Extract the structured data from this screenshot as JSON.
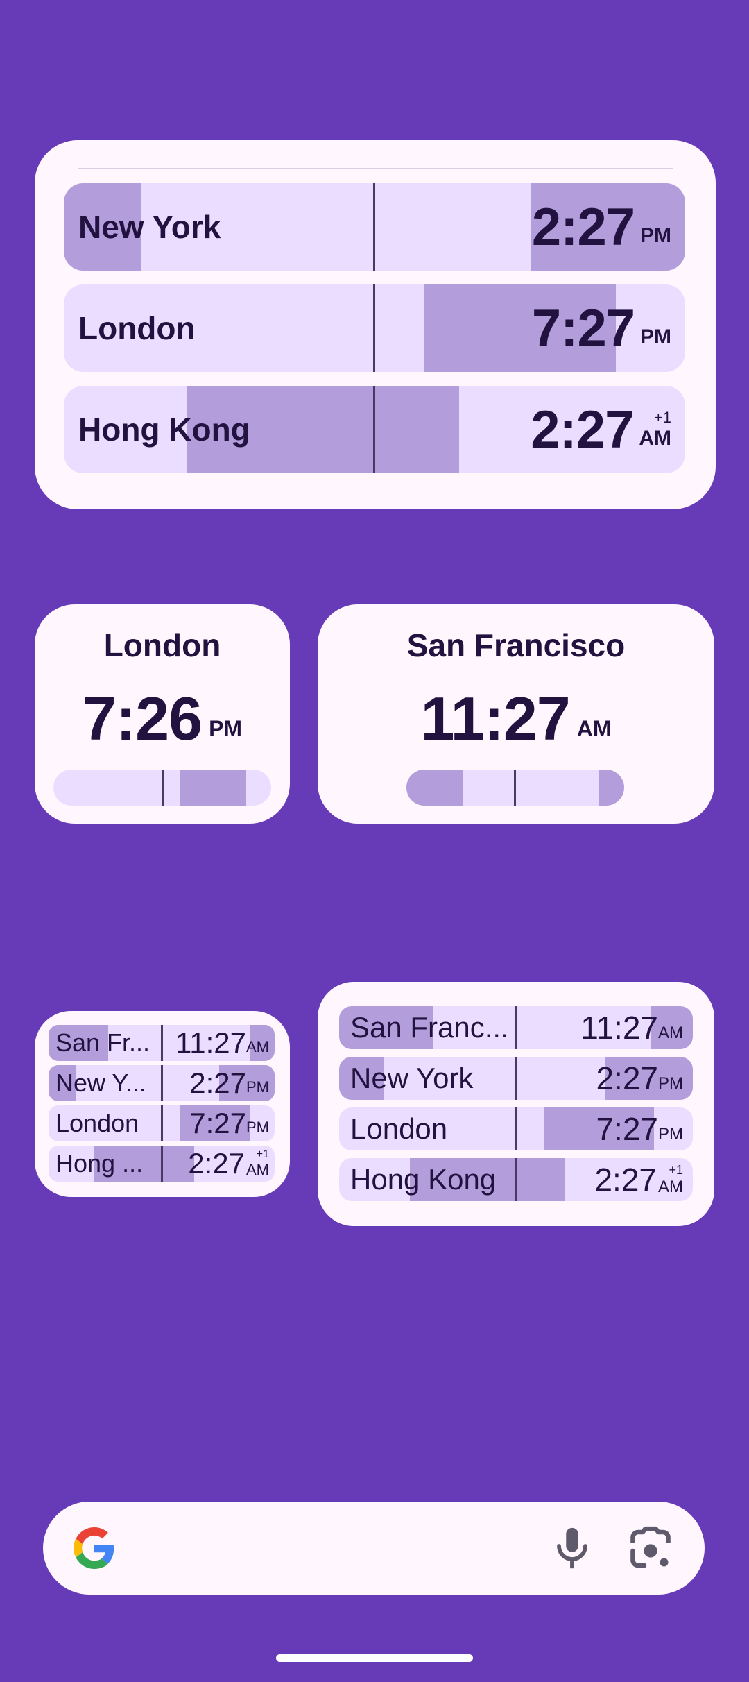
{
  "large_widget": {
    "rows": [
      {
        "city": "New York",
        "time": "2:27",
        "ampm": "PM",
        "offset": ""
      },
      {
        "city": "London",
        "time": "7:27",
        "ampm": "PM",
        "offset": ""
      },
      {
        "city": "Hong Kong",
        "time": "2:27",
        "ampm": "AM",
        "offset": "+1"
      }
    ]
  },
  "london_widget": {
    "city": "London",
    "time": "7:26",
    "ampm": "PM"
  },
  "sf_widget": {
    "city": "San Francisco",
    "time": "11:27",
    "ampm": "AM"
  },
  "small_widget": {
    "rows": [
      {
        "city": "San Fr...",
        "time": "11:27",
        "ampm": "AM",
        "offset": ""
      },
      {
        "city": "New Y...",
        "time": "2:27",
        "ampm": "PM",
        "offset": ""
      },
      {
        "city": "London",
        "time": "7:27",
        "ampm": "PM",
        "offset": ""
      },
      {
        "city": "Hong ...",
        "time": "2:27",
        "ampm": "AM",
        "offset": "+1"
      }
    ]
  },
  "medium_list_widget": {
    "rows": [
      {
        "city": "San Franc...",
        "time": "11:27",
        "ampm": "AM",
        "offset": ""
      },
      {
        "city": "New York",
        "time": "2:27",
        "ampm": "PM",
        "offset": ""
      },
      {
        "city": "London",
        "time": "7:27",
        "ampm": "PM",
        "offset": ""
      },
      {
        "city": "Hong Kong",
        "time": "2:27",
        "ampm": "AM",
        "offset": "+1"
      }
    ]
  },
  "search_bar": {
    "logo": "google-g-icon",
    "mic": "mic-icon",
    "lens": "google-lens-icon"
  },
  "colors": {
    "background": "#673AB7",
    "card": "#FFF7FD",
    "row": "#EADDFF",
    "band": "#B39DDB",
    "text": "#21123f"
  }
}
